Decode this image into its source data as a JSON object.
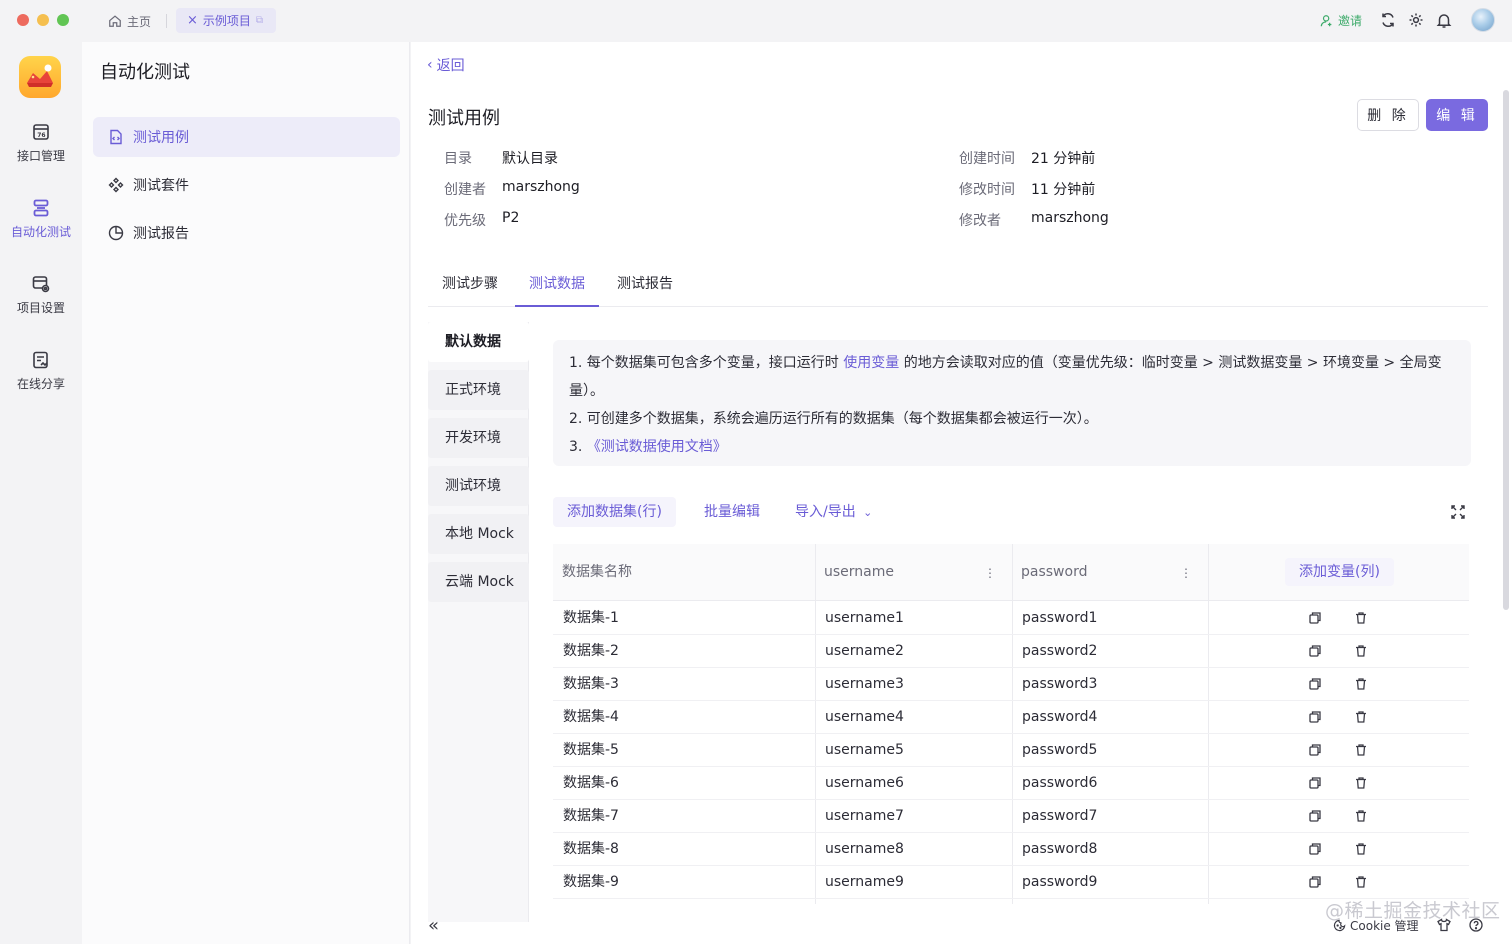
{
  "titlebar": {
    "home_tab": "主页",
    "project_tab": "示例项目",
    "invite": "邀请"
  },
  "leftnav": {
    "items": [
      {
        "label": "接口管理",
        "icon": "api-icon"
      },
      {
        "label": "自动化测试",
        "icon": "automation-icon"
      },
      {
        "label": "项目设置",
        "icon": "settings-icon"
      },
      {
        "label": "在线分享",
        "icon": "share-icon"
      }
    ],
    "active_index": 1
  },
  "secnav": {
    "title": "自动化测试",
    "items": [
      {
        "label": "测试用例",
        "icon": "file-code-icon"
      },
      {
        "label": "测试套件",
        "icon": "suite-icon"
      },
      {
        "label": "测试报告",
        "icon": "pie-chart-icon"
      }
    ]
  },
  "main": {
    "back": "返回",
    "title": "测试用例",
    "delete_label": "删 除",
    "edit_label": "编 辑",
    "meta": {
      "dir_label": "目录",
      "dir": "默认目录",
      "creator_label": "创建者",
      "creator": "marszhong",
      "priority_label": "优先级",
      "priority": "P2",
      "created_label": "创建时间",
      "created": "21 分钟前",
      "modified_label": "修改时间",
      "modified": "11 分钟前",
      "modifier_label": "修改者",
      "modifier": "marszhong"
    },
    "tabs": [
      "测试步骤",
      "测试数据",
      "测试报告"
    ],
    "active_tab": 1,
    "envs": [
      "默认数据",
      "正式环境",
      "开发环境",
      "测试环境",
      "本地 Mock",
      "云端 Mock"
    ],
    "info": {
      "line1_a": "1. 每个数据集可包含多个变量，接口运行时 ",
      "line1_link": "使用变量",
      "line1_b": " 的地方会读取对应的值（变量优先级：临时变量 > 测试数据变量 > 环境变量 > 全局变",
      "line1_c": "量）。",
      "line2": "2. 可创建多个数据集，系统会遍历运行所有的数据集（每个数据集都会被运行一次）。",
      "line3_num": "3. ",
      "line3_link": "《测试数据使用文档》"
    },
    "toolbar": {
      "add_row": "添加数据集(行)",
      "bulk_edit": "批量编辑",
      "import_export": "导入/导出"
    },
    "table": {
      "headers": [
        "数据集名称",
        "username",
        "password"
      ],
      "add_col": "添加变量(列)",
      "rows": [
        [
          "数据集-1",
          "username1",
          "password1"
        ],
        [
          "数据集-2",
          "username2",
          "password2"
        ],
        [
          "数据集-3",
          "username3",
          "password3"
        ],
        [
          "数据集-4",
          "username4",
          "password4"
        ],
        [
          "数据集-5",
          "username5",
          "password5"
        ],
        [
          "数据集-6",
          "username6",
          "password6"
        ],
        [
          "数据集-7",
          "username7",
          "password7"
        ],
        [
          "数据集-8",
          "username8",
          "password8"
        ],
        [
          "数据集-9",
          "username9",
          "password9"
        ]
      ]
    }
  },
  "bottombar": {
    "watermark": "@稀土掘金技术社区",
    "cookie": "Cookie 管理"
  },
  "colors": {
    "accent": "#6a5cd6",
    "button": "#7a6ae0",
    "invite": "#3daa6a"
  }
}
